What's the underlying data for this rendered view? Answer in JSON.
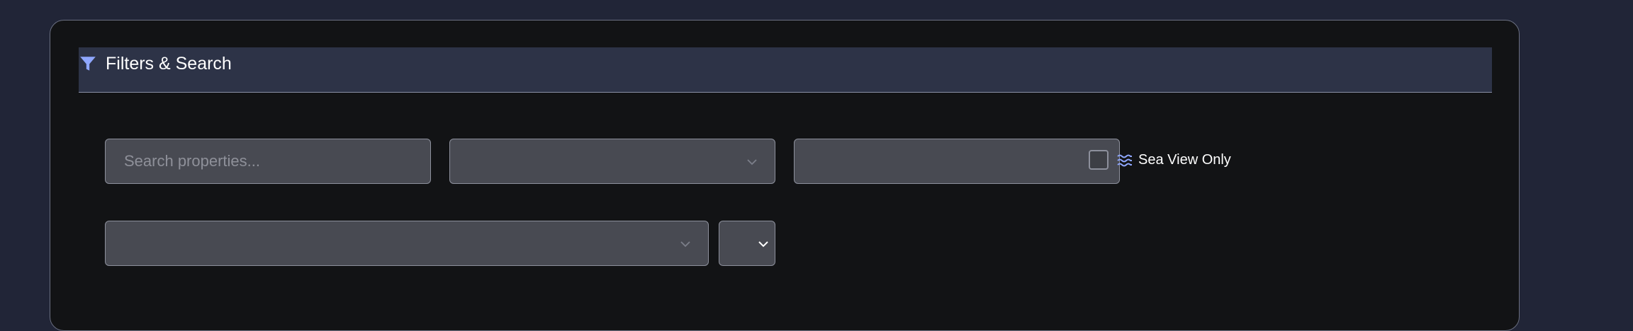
{
  "filters": {
    "title": "Filters & Search",
    "icon": "filter-icon",
    "search": {
      "placeholder": "Search properties...",
      "value": ""
    },
    "select_1": {
      "value": ""
    },
    "select_2": {
      "value": ""
    },
    "sea_view": {
      "label": "Sea View Only",
      "checked": false,
      "icon": "waves-icon"
    },
    "select_3": {
      "value": ""
    },
    "select_4": {
      "value": ""
    }
  },
  "colors": {
    "page_bg": "#212537",
    "panel_bg": "#121315",
    "header_bg": "#2d3347",
    "field_bg": "#484a52",
    "accent": "#8fa7ff"
  }
}
